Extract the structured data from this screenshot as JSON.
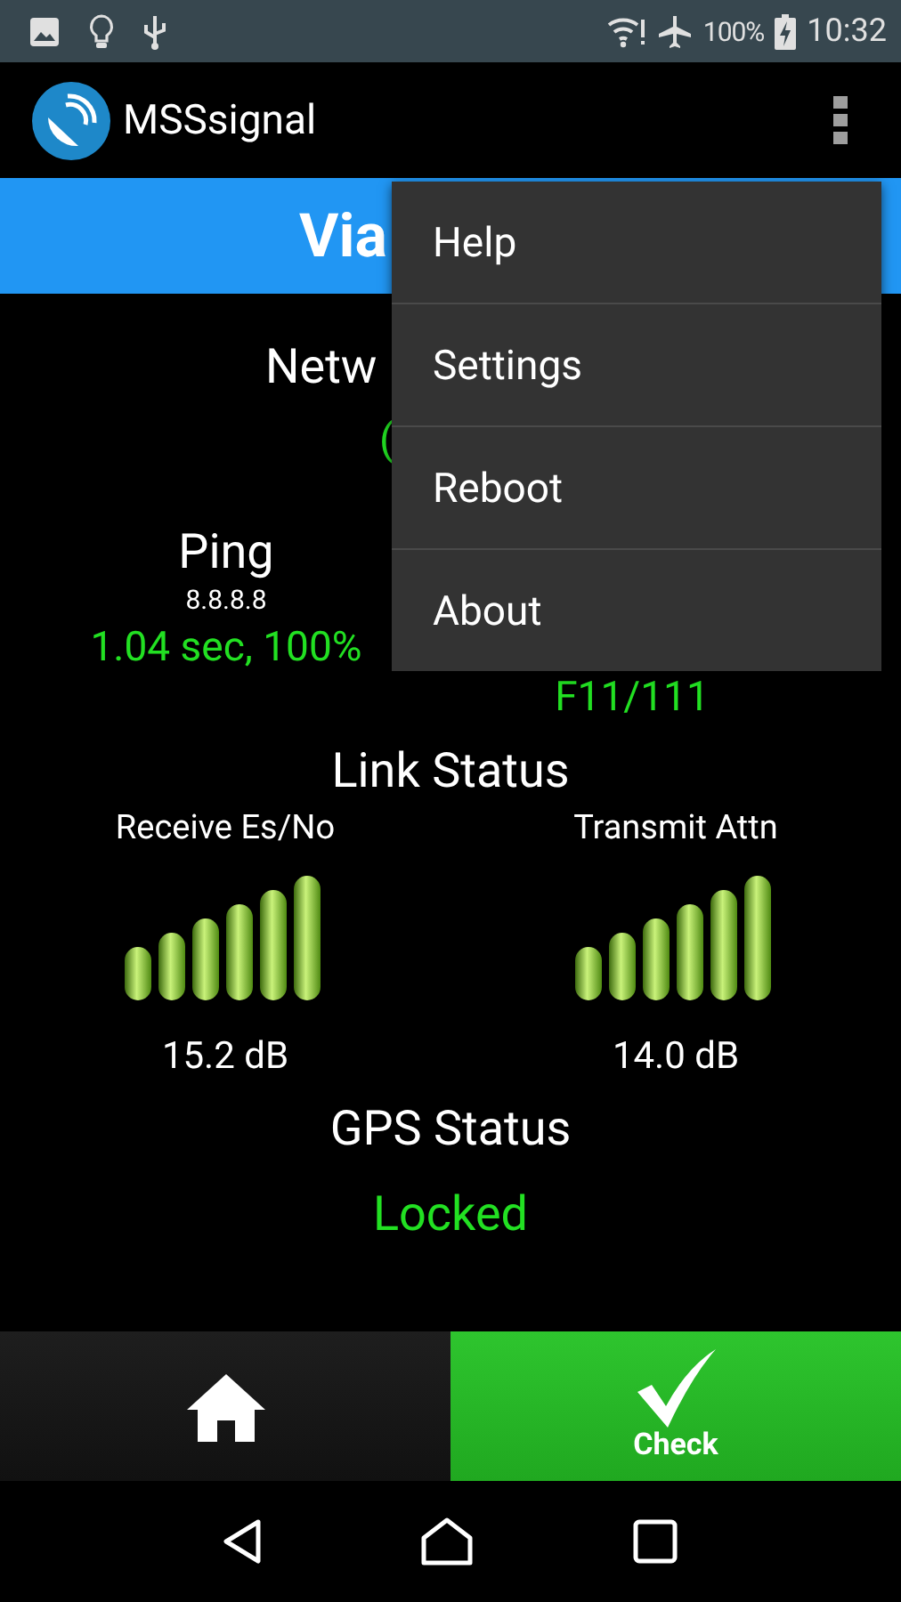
{
  "status_bar": {
    "battery": "100%",
    "time": "10:32"
  },
  "app_bar": {
    "title": "MSSsignal"
  },
  "banner": {
    "title": "Via"
  },
  "network": {
    "label": "Netw",
    "value": "("
  },
  "ping": {
    "label": "Ping",
    "host": "8.8.8.8",
    "value": "1.04 sec, 100%"
  },
  "column_2": {
    "value": "F11/111"
  },
  "link_status": {
    "title": "Link Status",
    "meters": [
      {
        "label": "Receive Es/No",
        "reading": "15.2 dB"
      },
      {
        "label": "Transmit Attn",
        "reading": "14.0 dB"
      }
    ]
  },
  "gps_status": {
    "title": "GPS Status",
    "value": "Locked"
  },
  "bottom_tabs": [
    {
      "kind": "home",
      "selected": false
    },
    {
      "kind": "check",
      "label": "Check",
      "selected": true
    }
  ],
  "menu": {
    "items": [
      "Help",
      "Settings",
      "Reboot",
      "About"
    ]
  }
}
